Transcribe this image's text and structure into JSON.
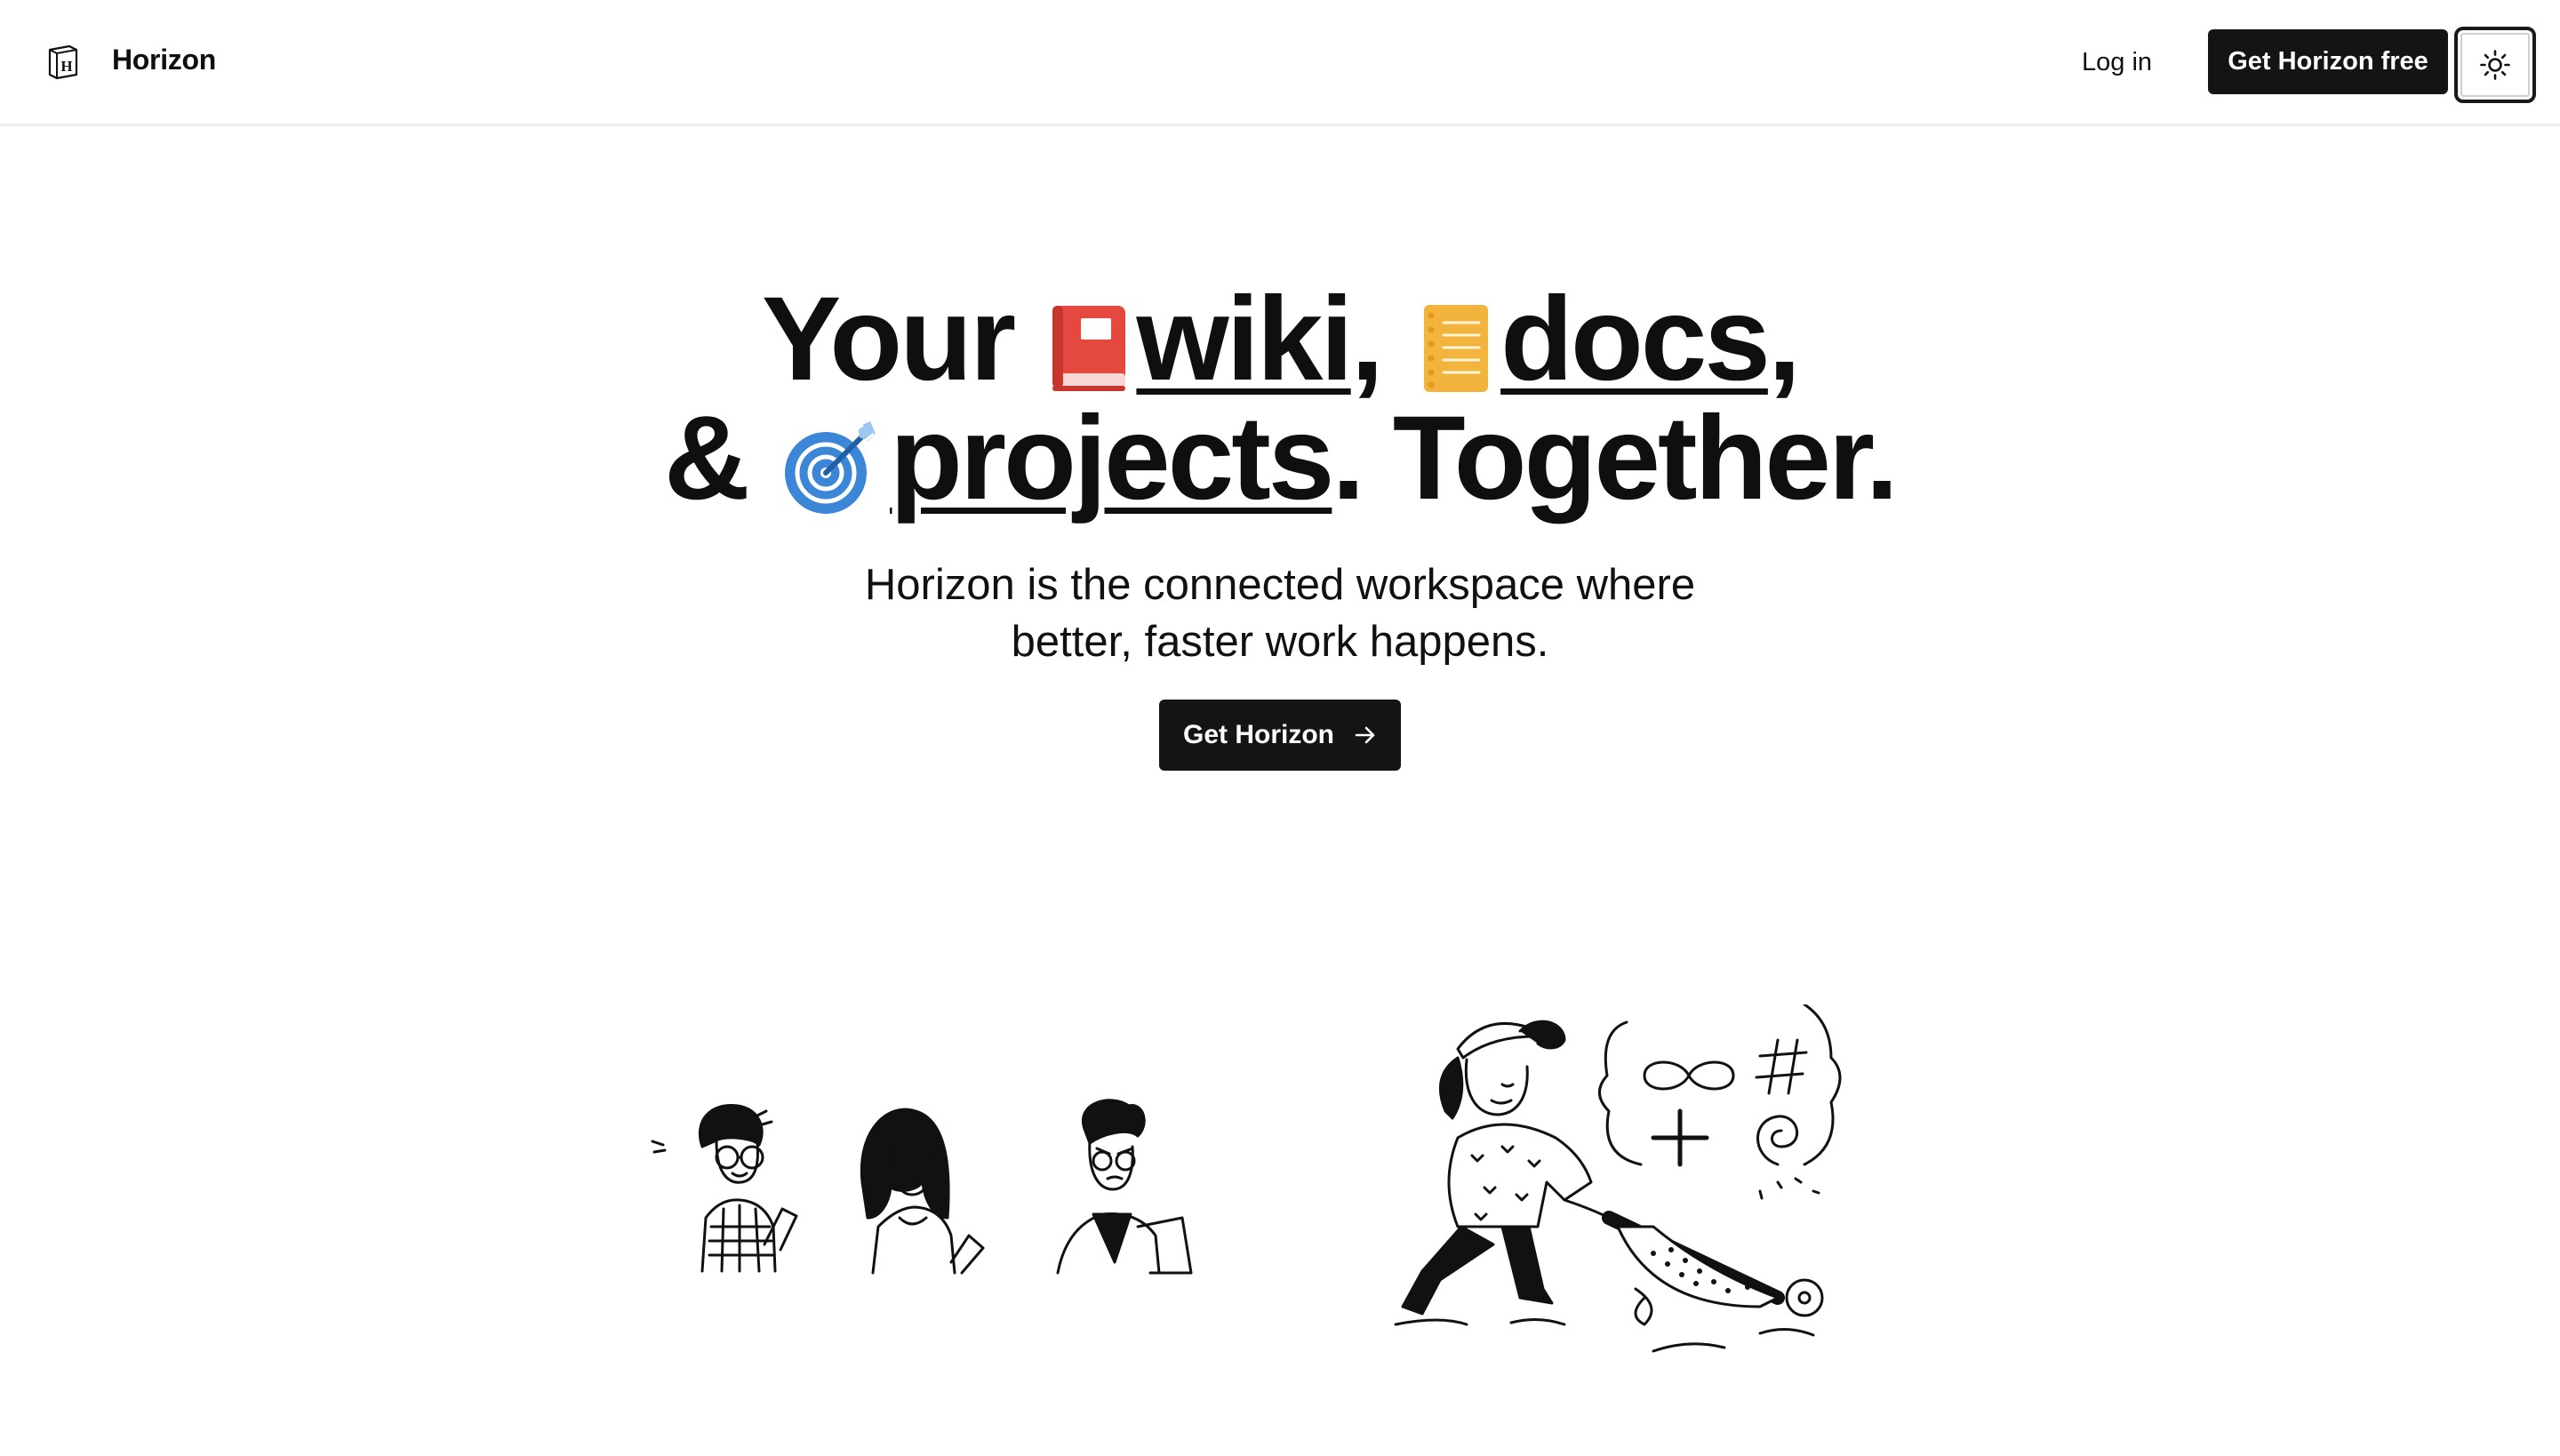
{
  "header": {
    "brand_name": "Horizon",
    "login_label": "Log in",
    "cta_label": "Get Horizon free",
    "theme_icon": "sun-icon"
  },
  "hero": {
    "line1": {
      "prefix": "Your",
      "word1": "wiki",
      "sep": ",",
      "word2": "docs",
      "suffix": ","
    },
    "line2": {
      "prefix": "&",
      "word": "projects",
      "suffix": ". Together."
    },
    "icons": [
      "book-icon",
      "notebook-icon",
      "target-icon"
    ],
    "subtitle_line1": "Horizon is the connected workspace where",
    "subtitle_line2": "better, faster work happens.",
    "cta_label": "Get Horizon",
    "cta_icon": "arrow-right-icon"
  },
  "illustrations": [
    "three-people-illustration",
    "person-pushing-wheelbarrow-illustration"
  ],
  "colors": {
    "dark_button": "#141414",
    "book_red": "#e5483f",
    "notebook_yellow": "#f2b43c",
    "target_blue": "#3b86d6"
  }
}
